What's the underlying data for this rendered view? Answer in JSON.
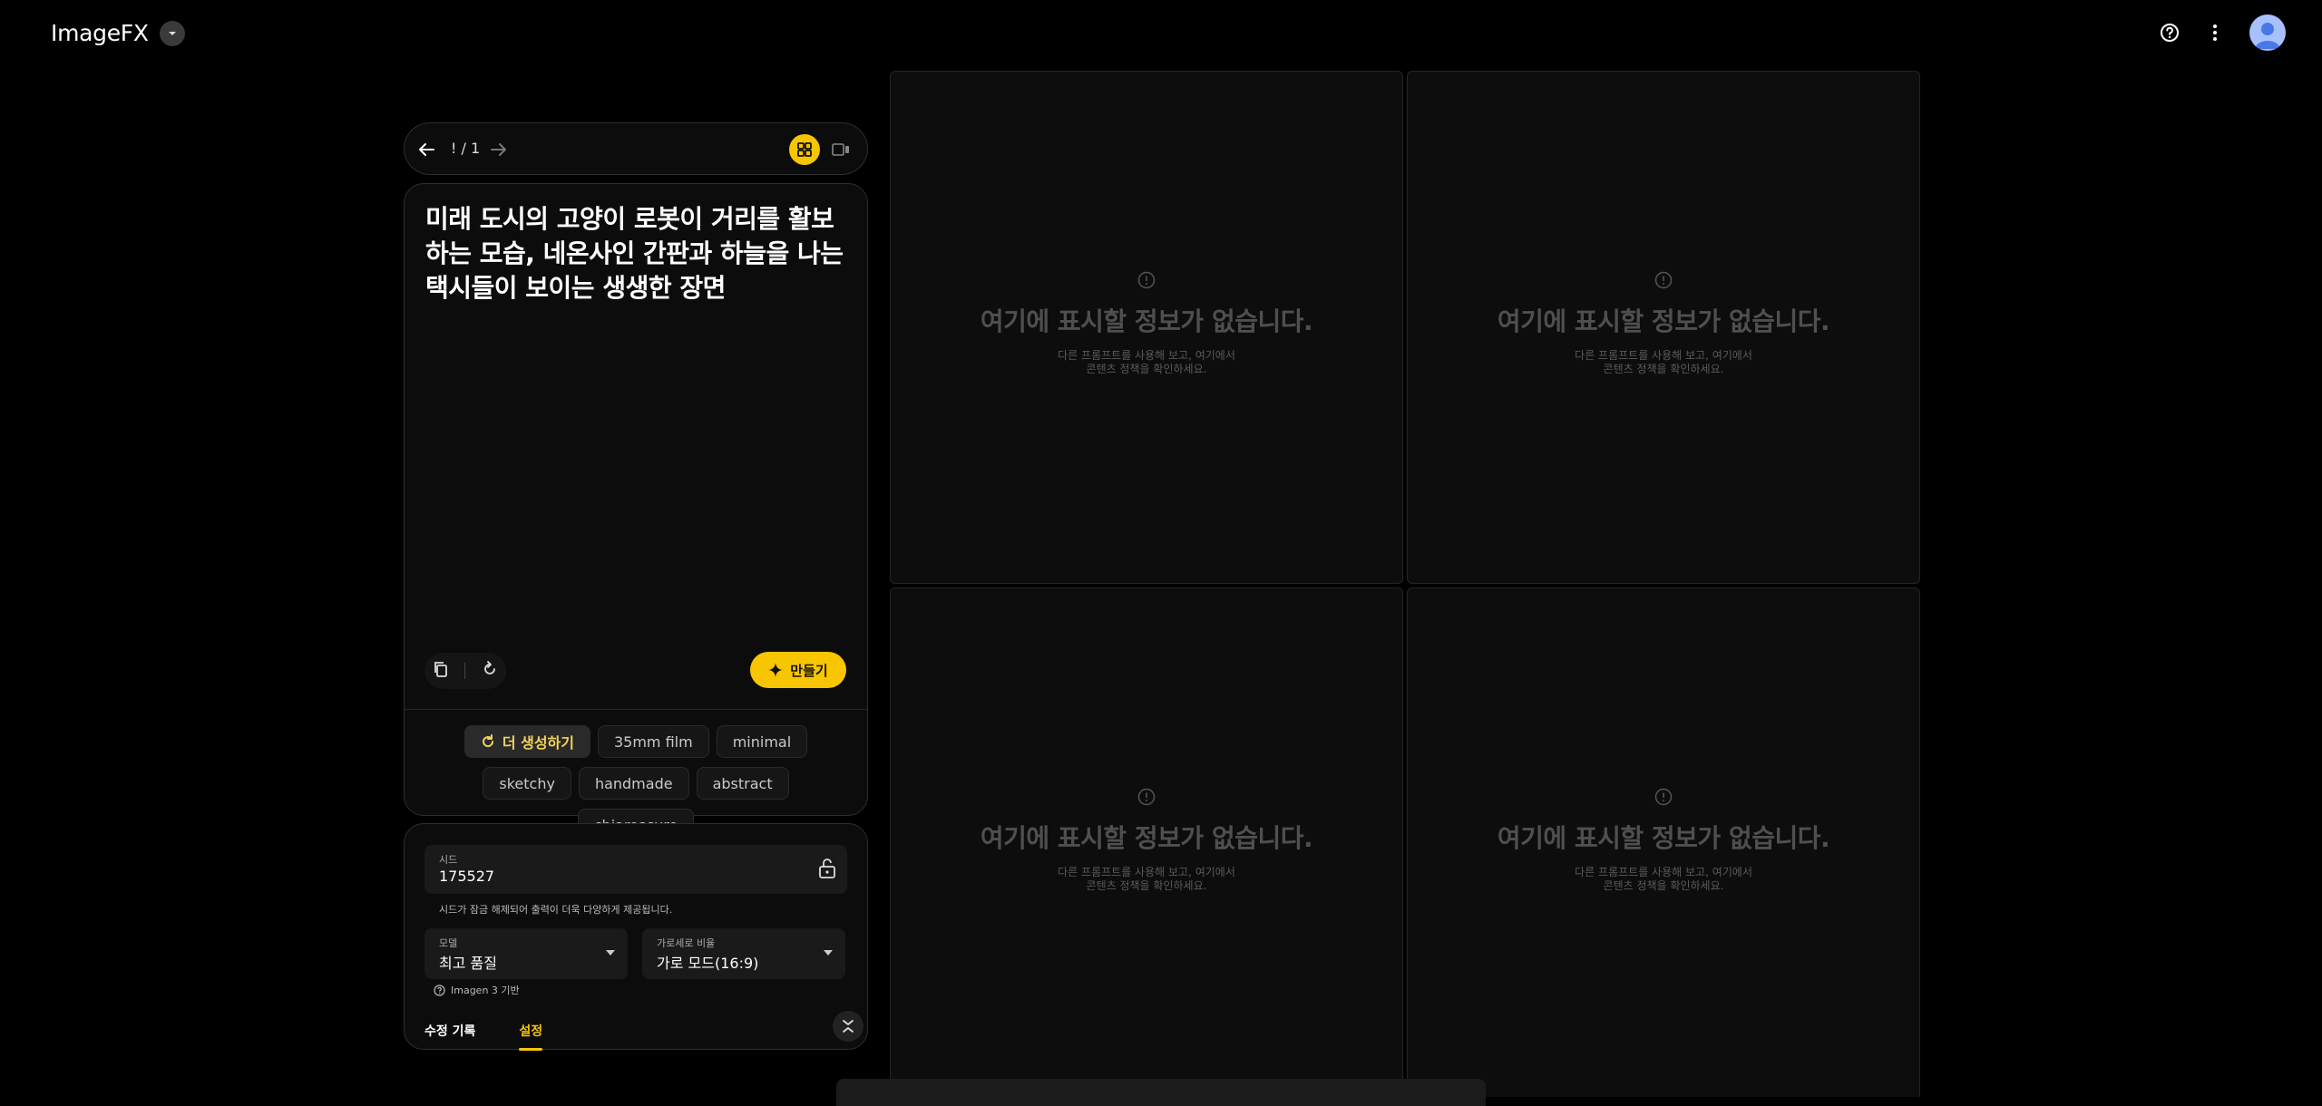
{
  "app": {
    "title": "ImageFX"
  },
  "nav": {
    "page_indicator": "! / 1"
  },
  "prompt": {
    "text": "미래 도시의 고양이 로봇이 거리를 활보하는 모습, 네온사인 간판과 하늘을 나는 택시들이 보이는 생생한 장면"
  },
  "actions": {
    "create_label": "만들기"
  },
  "chips": {
    "more_label": "더 생성하기",
    "items": [
      "35mm film",
      "minimal",
      "sketchy",
      "handmade",
      "abstract",
      "chiaroscuro"
    ]
  },
  "settings": {
    "seed_label": "시드",
    "seed_value": "175527",
    "seed_note": "시드가 잠금 해제되어 출력이 더욱 다양하게 제공됩니다.",
    "model_label": "모델",
    "model_value": "최고 품질",
    "ratio_label": "가로세로 비율",
    "ratio_value": "가로 모드(16:9)",
    "model_note": "Imagen 3 기반"
  },
  "tabs": {
    "history": "수정 기록",
    "settings": "설정"
  },
  "empty_state": {
    "title": "여기에 표시할 정보가 없습니다.",
    "sub_line1": "다른 프롬프트를 사용해 보고, 여기에서",
    "sub_line2": "콘텐츠 정책을 확인하세요."
  },
  "colors": {
    "accent": "#f7c600",
    "background": "#000000"
  }
}
